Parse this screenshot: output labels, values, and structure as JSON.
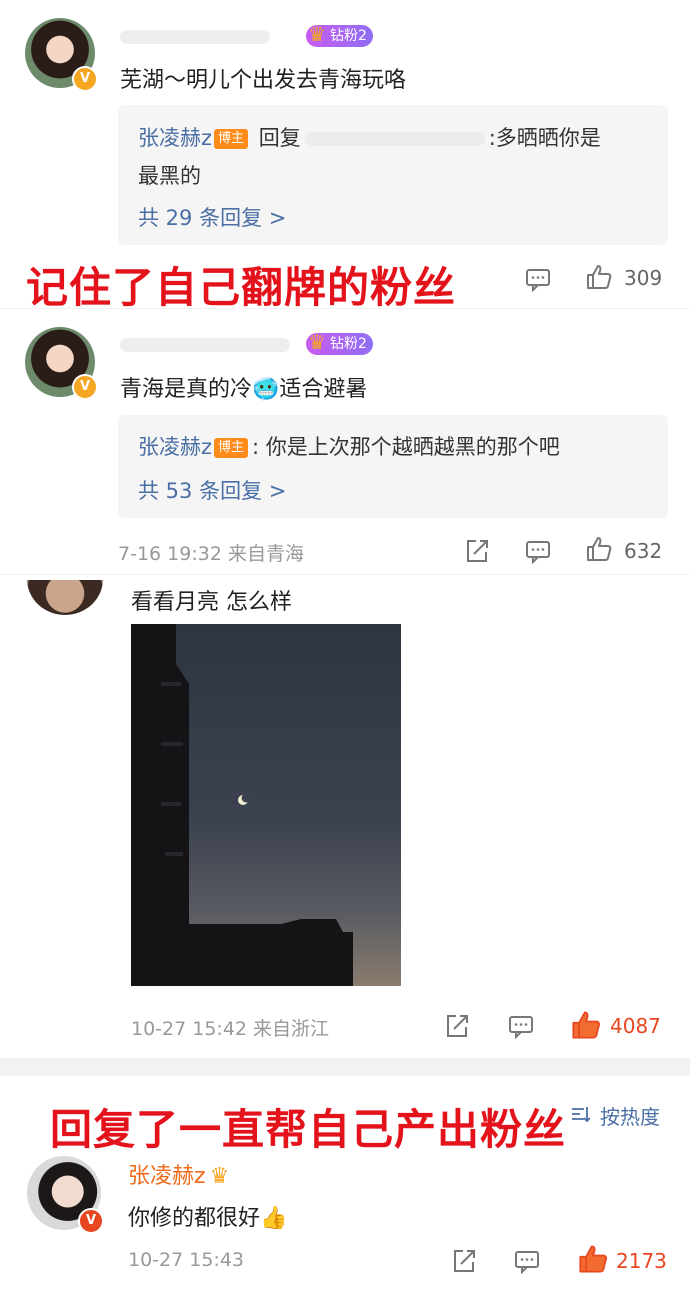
{
  "comment1": {
    "fan_badge": "钻粉2",
    "text": "芜湖～明儿个出发去青海玩咯",
    "reply": {
      "author": "张凌赫z",
      "tag": "博主",
      "prefix": "回复",
      "text": ":多晒晒你是",
      "text2": "最黑的"
    },
    "reply_count": "共 29 条回复 >",
    "likes": "309"
  },
  "overlay1": "记住了自己翻牌的粉丝",
  "comment2": {
    "fan_badge": "钻粉2",
    "text_a": "青海是真的冷",
    "emoji": "🥶",
    "text_b": "适合避暑",
    "reply": {
      "author": "张凌赫z",
      "tag": "博主",
      "text": ": 你是上次那个越晒越黑的那个吧"
    },
    "reply_count": "共 53 条回复 >",
    "meta": "7-16 19:32  来自青海",
    "likes": "632"
  },
  "comment3": {
    "text": "看看月亮 怎么样",
    "meta": "10-27 15:42  来自浙江",
    "likes": "4087"
  },
  "overlay2": "回复了一直帮自己产出粉丝",
  "sort": {
    "label": "按热度"
  },
  "comment4": {
    "author": "张凌赫z",
    "text": "你修的都很好",
    "emoji": "👍",
    "meta": "10-27 15:43",
    "likes": "2173"
  },
  "colors": {
    "link_blue": "#4a6fa5",
    "overlay_red": "#e3121b",
    "hot_orange": "#e8461f"
  }
}
